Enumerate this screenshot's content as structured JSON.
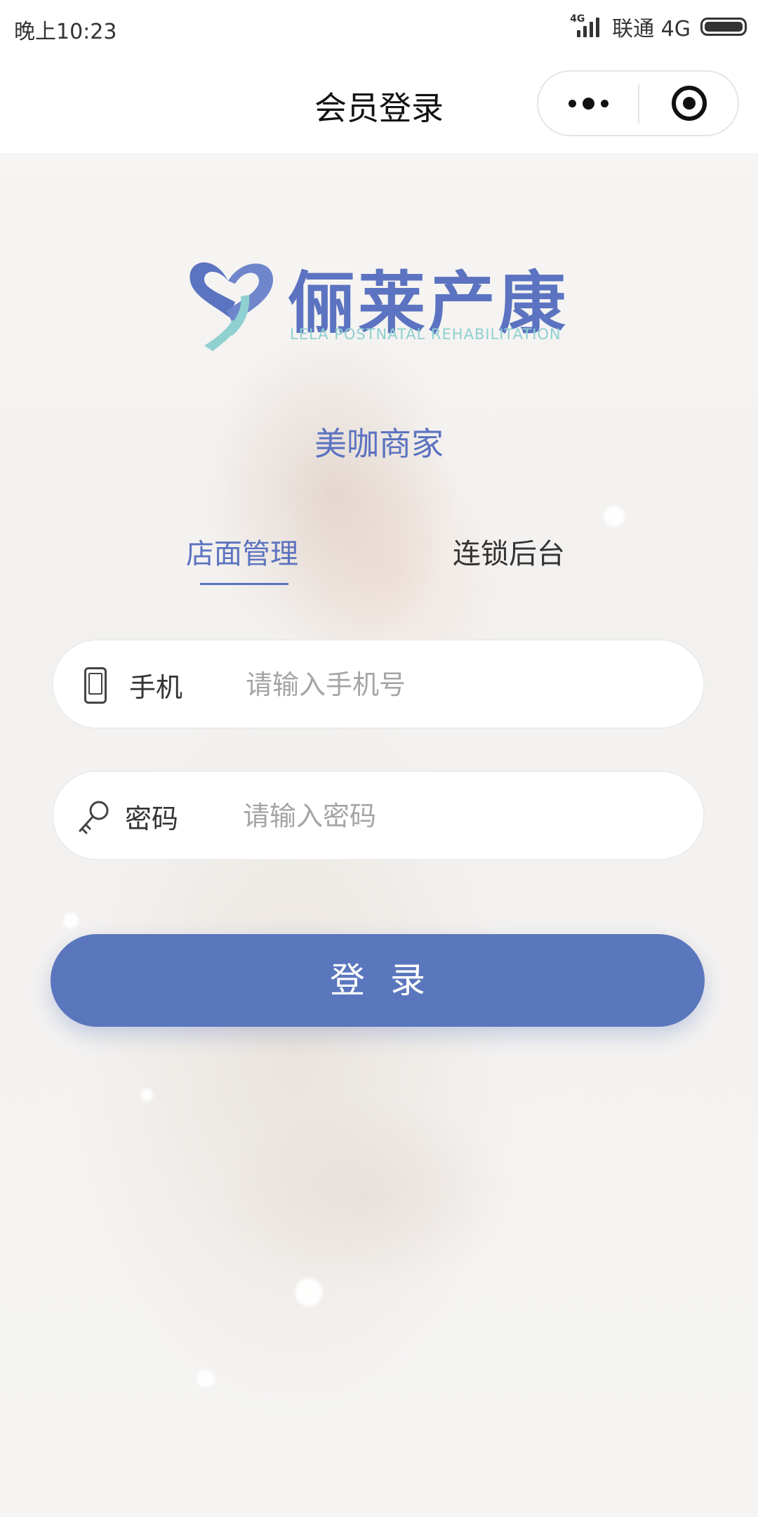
{
  "status_bar": {
    "time": "晚上10:23",
    "network_badge": "4G",
    "carrier": "联通 4G",
    "icons": [
      "signal-icon",
      "battery-icon"
    ]
  },
  "nav": {
    "title": "会员登录",
    "capsule_icons": [
      "more-icon",
      "target-icon"
    ]
  },
  "logo": {
    "name": "俪莱产康",
    "english": "LELA POSTNATAL REHABILITATION",
    "colors": {
      "primary": "#5b73c0",
      "accent": "#8fd0d0"
    }
  },
  "merchant_title": "美咖商家",
  "tabs": [
    {
      "label": "店面管理",
      "active": true
    },
    {
      "label": "连锁后台",
      "active": false
    }
  ],
  "form": {
    "phone": {
      "label": "手机",
      "placeholder": "请输入手机号",
      "value": ""
    },
    "password": {
      "label": "密码",
      "placeholder": "请输入密码",
      "value": ""
    }
  },
  "login_button": "登录",
  "theme": {
    "accent": "#5a76bd",
    "background": "#f6f5f4"
  }
}
